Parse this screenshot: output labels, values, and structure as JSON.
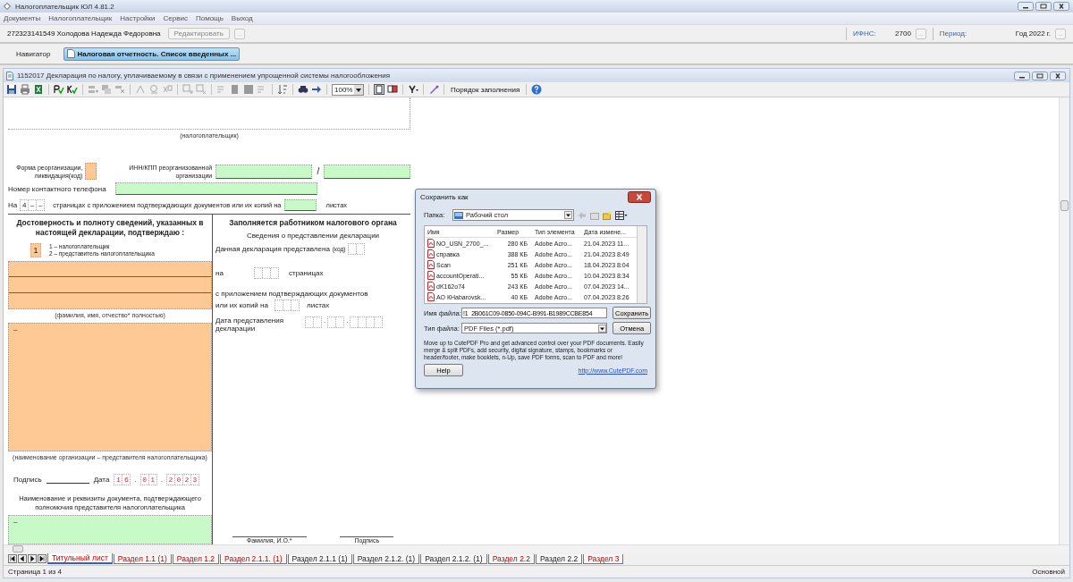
{
  "window": {
    "title": "Налогоплательщик ЮЛ 4.81.2"
  },
  "menu": [
    "Документы",
    "Налогоплательщик",
    "Настройки",
    "Сервис",
    "Помощь",
    "Выход"
  ],
  "taxpayer": {
    "name": "272323141549 Холодова Надежда Федоровна",
    "edit_button": "Редактировать",
    "edit_more": "...",
    "ifns_label": "ИФНС:",
    "ifns_value": "2700",
    "ifns_more": "...",
    "period_label": "Период:",
    "period_value": "Год 2022 г.",
    "period_more": "..."
  },
  "navigator": {
    "label": "Навигатор",
    "tab": "Налоговая отчетность. Список введенных ..."
  },
  "document": {
    "title": "1152017  Декларация по налогу, уплачиваемому в связи с применением упрощенной системы налогообложения",
    "zoom": "100%",
    "fill_order": "Порядок заполнения"
  },
  "form": {
    "taxpayer_caption": "(налогоплательщик)",
    "reorg_label": "Форма реорганизации, ликвидация(код)",
    "reorg_inn_label": "ИНН/КПП реорганизованной организации",
    "inn_kpp_separator": "/",
    "phone_label": "Номер контактного телефона",
    "pages_prefix": "На",
    "pages_cells": [
      "4",
      "–",
      "–"
    ],
    "pages_text": "страницах с приложением подтверждающих документов или их копий на",
    "sheets_label": "листах",
    "confirm_heading": "Достоверность и полноту сведений, указанных в настоящей декларации, подтверждаю :",
    "signer_code": "1",
    "signer_options": [
      "1 – налогоплательщик",
      "2 – представитель налогоплательщика"
    ],
    "name_caption": "(фамилия, имя, отчество* полностью)",
    "org_value": "–",
    "org_caption": "(наименование организации – представителя налогоплательщика)",
    "signature_label": "Подпись",
    "date_label": "Дата",
    "date_parts": [
      [
        "1",
        "6"
      ],
      [
        "0",
        "1"
      ],
      [
        "2",
        "0",
        "2",
        "3"
      ]
    ],
    "date_separators": [
      ".",
      "."
    ],
    "doc_heading": "Наименование и реквизиты документа, подтверждающего полномочия представителя налогоплательщика",
    "doc_value": "–",
    "office": {
      "heading": "Заполняется работником налогового органа",
      "subheading": "Сведения о представлении декларации",
      "submitted_label": "Данная декларация представлена",
      "code_label": "(код)",
      "on_label": "на",
      "pages_label": "страницах",
      "attach_label": "с приложением подтверждающих документов",
      "copies_label": "или их копий на",
      "sheets_label": "листах",
      "date_label": "Дата представления декларации",
      "date_separators": [
        ".",
        "."
      ],
      "name_caption": "Фамилия, И.О.*",
      "signature_caption": "Подпись"
    }
  },
  "dialog": {
    "title": "Сохранить как",
    "folder_label": "Папка:",
    "folder": "Рабочий стол",
    "columns": [
      "Имя",
      "Размер",
      "Тип элемента",
      "Дата измене..."
    ],
    "files": [
      {
        "name": "NO_USN_2700_...",
        "size": "280 КБ",
        "type": "Adobe Acro...",
        "date": "21.04.2023 11..."
      },
      {
        "name": "справка",
        "size": "388 КБ",
        "type": "Adobe Acro...",
        "date": "21.04.2023 8:49"
      },
      {
        "name": "Scan",
        "size": "251 КБ",
        "type": "Adobe Acro...",
        "date": "18.04.2023 8:04"
      },
      {
        "name": "accountOperati...",
        "size": "55 КБ",
        "type": "Adobe Acro...",
        "date": "10.04.2023 8:34"
      },
      {
        "name": "dK162o74",
        "size": "243 КБ",
        "type": "Adobe Acro...",
        "date": "07.04.2023 14..."
      },
      {
        "name": "АО КHabarovsk...",
        "size": "40 КБ",
        "type": "Adobe Acro...",
        "date": "07.04.2023 8:26"
      }
    ],
    "filename_label": "Имя файла:",
    "filename": "!1_2B061C09-0850-094C-B991-B1989CCBE854",
    "filetype_label": "Тип файла:",
    "filetype": "PDF Files (*.pdf)",
    "save_button": "Сохранить",
    "cancel_button": "Отмена",
    "promo": "Move up to CutePDF Pro and get advanced control over your PDF documents. Easily merge & split PDFs, add security, digital signature, stamps, bookmarks or header/footer, make booklets, n-Up, save PDF forms, scan to PDF and more!",
    "help_button": "Help",
    "link": "http://www.CutePDF.com"
  },
  "sheet_tabs": [
    {
      "label": "Титульный лист",
      "selected": true,
      "error": true
    },
    {
      "label": "Раздел 1.1 (1)",
      "selected": false,
      "error": true
    },
    {
      "label": "Раздел 1.2",
      "selected": false,
      "error": true
    },
    {
      "label": "Раздел 2.1.1. (1)",
      "selected": false,
      "error": true
    },
    {
      "label": "Раздел 2.1.1 (1)",
      "selected": false,
      "error": false
    },
    {
      "label": "Раздел 2.1.2. (1)",
      "selected": false,
      "error": false
    },
    {
      "label": "Раздел 2.1.2. (1)",
      "selected": false,
      "error": false
    },
    {
      "label": "Раздел 2.2",
      "selected": false,
      "error": true
    },
    {
      "label": "Раздел 2.2",
      "selected": false,
      "error": false
    },
    {
      "label": "Раздел 3",
      "selected": false,
      "error": true
    }
  ],
  "status_bar": {
    "page": "Страница 1 из 4",
    "mode": "Основной"
  }
}
